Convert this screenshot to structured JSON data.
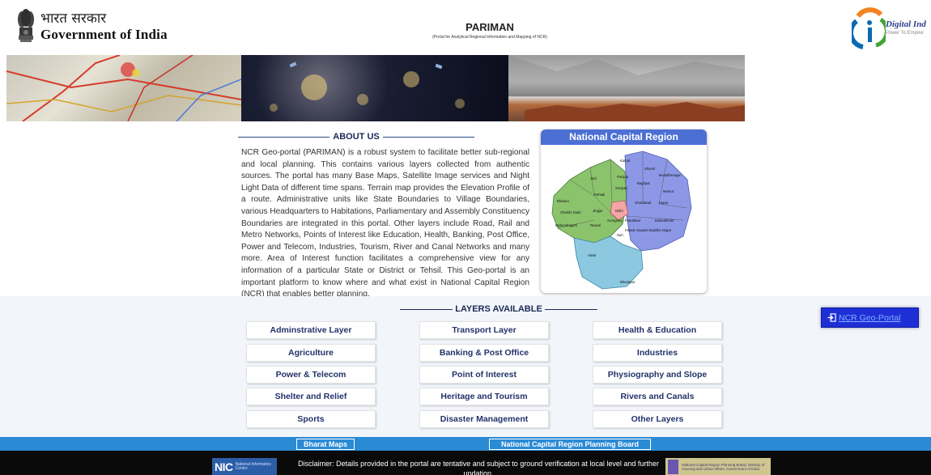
{
  "header": {
    "goi_hindi": "भारत सरकार",
    "goi_english": "Government of India",
    "title": "PARIMAN",
    "subtitle": "(Portal for Analytical Regional Information and Mapping of NCR)",
    "digital_india": "Digital Ind",
    "digital_india_sub": "Power To Empow"
  },
  "about": {
    "heading": "ABOUT US",
    "body": "NCR Geo-portal (PARIMAN) is a robust system to facilitate better sub-regional and local planning. This contains various layers collected from authentic sources. The portal has many Base Maps, Satellite Image services and Night Light Data of different time spans. Terrain map provides the Elevation Profile of a route. Administrative units like State Boundaries to Village Boundaries, various Headquarters to Habitations, Parliamentary and Assembly Constituency Boundaries are integrated in this portal. Other layers include Road, Rail and Metro Networks, Points of Interest like Education, Health, Banking, Post Office, Power and Telecom, Industries, Tourism, River and Canal Networks and many more. Area of Interest function facilitates a comprehensive view for any information of a particular State or District or Tehsil. This Geo-portal is an important platform to know where and what exist in National Capital Region (NCR) that enables better planning."
  },
  "ncr_card": {
    "title": "National Capital Region",
    "labels": [
      "Karnal",
      "Shamli",
      "Jind",
      "Panipat",
      "Muzaffarnagar",
      "Baghpat",
      "Sonipat",
      "Meerut",
      "Bhiwani",
      "Rohtak",
      "Charkhi Dadri",
      "Jhajjar",
      "Delhi",
      "Ghaziabad",
      "Hapur",
      "Mahendragarh",
      "Rewari",
      "Gurugram",
      "Faridabad",
      "Bulandshahr",
      "Nuh",
      "Palwal",
      "Gautam Buddha Nagar",
      "Alwar",
      "Bharatpur"
    ]
  },
  "layers": {
    "heading": "LAYERS AVAILABLE",
    "items": [
      "Adminstrative Layer",
      "Transport Layer",
      "Health & Education",
      "Agriculture",
      "Banking & Post Office",
      "Industries",
      "Power & Telecom",
      "Point of Interest",
      "Physiography and Slope",
      "Shelter and Relief",
      "Heritage and Tourism",
      "Rivers and Canals",
      "Sports",
      "Disaster Management",
      "Other Layers"
    ]
  },
  "portal_button": {
    "label": "NCR Geo-Portal",
    "icon": "sign-in-icon"
  },
  "bluebar": {
    "bharat_maps": "Bharat Maps",
    "ncrpb": "National Capital Region Planning Board"
  },
  "footer": {
    "nic_logo": "NIC",
    "nic_small": "National Informatics Centre",
    "disclaimer": "Disclaimer: Details provided in the portal are tentative and subject to ground verification at local level and further updation.",
    "ncrpb_logo_text": "National Capital Region Planning Board, Ministry of Housing and Urban Affairs, Government of India"
  },
  "colors": {
    "ncr_header": "#4c6fd4",
    "bluebar": "#2a8ad4",
    "portal_button": "#1f2fd6",
    "heading_text": "#1b2a55"
  }
}
